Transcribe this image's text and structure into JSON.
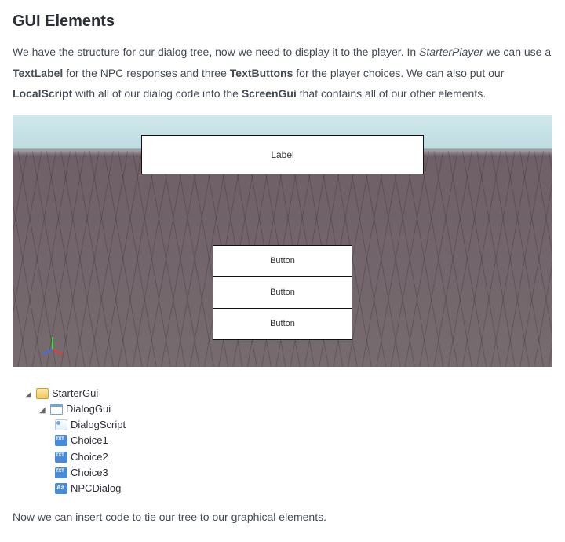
{
  "heading": "GUI Elements",
  "intro": {
    "p1a": "We have the structure for our dialog tree, now we need to display it to the player. In ",
    "starterPlayer": "StarterPlayer",
    "p1b": " we can use a ",
    "textLabel": "TextLabel",
    "p1c": " for the NPC responses and three ",
    "textButtons": "TextButtons",
    "p1d": " for the player choices. We can also put our ",
    "localScript": "LocalScript",
    "p1e": " with all of our dialog code into the ",
    "screenGui": "ScreenGui",
    "p1f": " that contains all of our other elements."
  },
  "gameView": {
    "label": "Label",
    "buttons": [
      "Button",
      "Button",
      "Button"
    ]
  },
  "tree": {
    "starterGui": "StarterGui",
    "dialogGui": "DialogGui",
    "dialogScript": "DialogScript",
    "choice1": "Choice1",
    "choice2": "Choice2",
    "choice3": "Choice3",
    "npcDialog": "NPCDialog"
  },
  "outro": "Now we can insert code to tie our tree to our graphical elements."
}
